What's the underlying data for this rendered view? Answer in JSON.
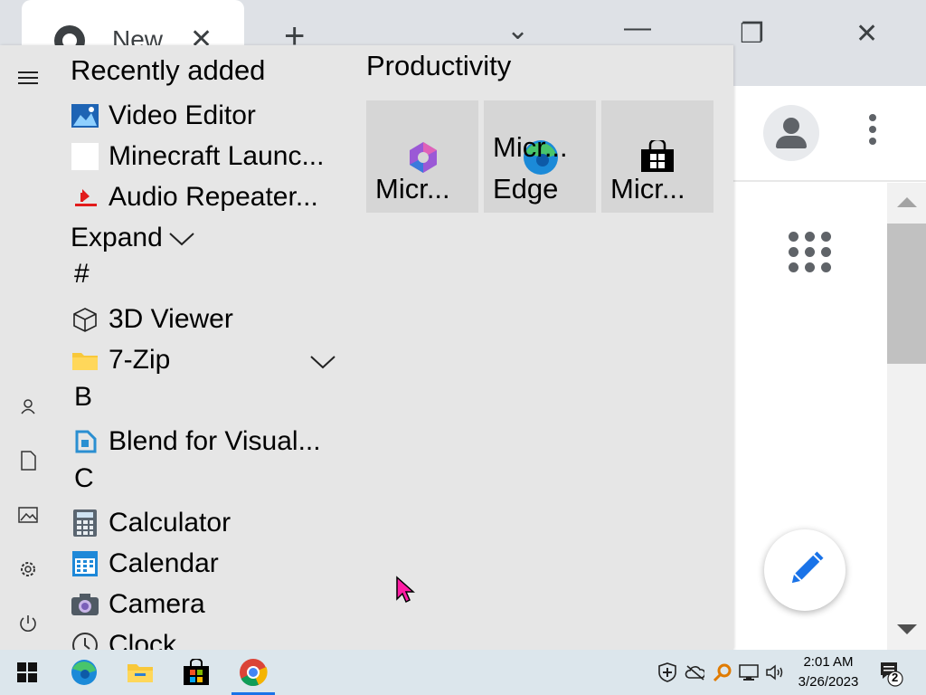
{
  "browser": {
    "tab_title": "New",
    "tab_close_glyph": "✕",
    "new_tab_glyph": "+",
    "window_controls": {
      "dropdown": "⌄",
      "minimize": "—",
      "maximize": "❐",
      "close": "✕"
    }
  },
  "start_menu": {
    "recently_added_label": "Recently added",
    "recent_apps": [
      {
        "label": "Video Editor",
        "icon": "video-editor-icon"
      },
      {
        "label": "Minecraft Launc...",
        "icon": "minecraft-icon"
      },
      {
        "label": "Audio Repeater...",
        "icon": "audio-repeater-icon"
      }
    ],
    "expand_label": "Expand",
    "sections": {
      "hash": "#",
      "b": "B",
      "c": "C"
    },
    "apps": {
      "viewer3d": "3D Viewer",
      "zip7": "7-Zip",
      "blend": "Blend for Visual...",
      "calculator": "Calculator",
      "calendar": "Calendar",
      "camera": "Camera",
      "clock": "Clock"
    },
    "tiles_group": "Productivity",
    "tiles": [
      {
        "line1": "",
        "line2": "Micr...",
        "icon": "microsoft-365-icon"
      },
      {
        "line1": "Micr...",
        "line2": "Edge",
        "icon": "edge-icon"
      },
      {
        "line1": "",
        "line2": "Micr...",
        "icon": "store-icon"
      }
    ]
  },
  "taskbar": {
    "clock_time": "2:01 AM",
    "clock_date": "3/26/2023",
    "notification_count": "2"
  },
  "colors": {
    "start_bg": "#e6e6e6",
    "taskbar_bg": "#dce6ec",
    "accent_blue": "#1a73e8",
    "tile_bg": "#d6d6d6"
  }
}
